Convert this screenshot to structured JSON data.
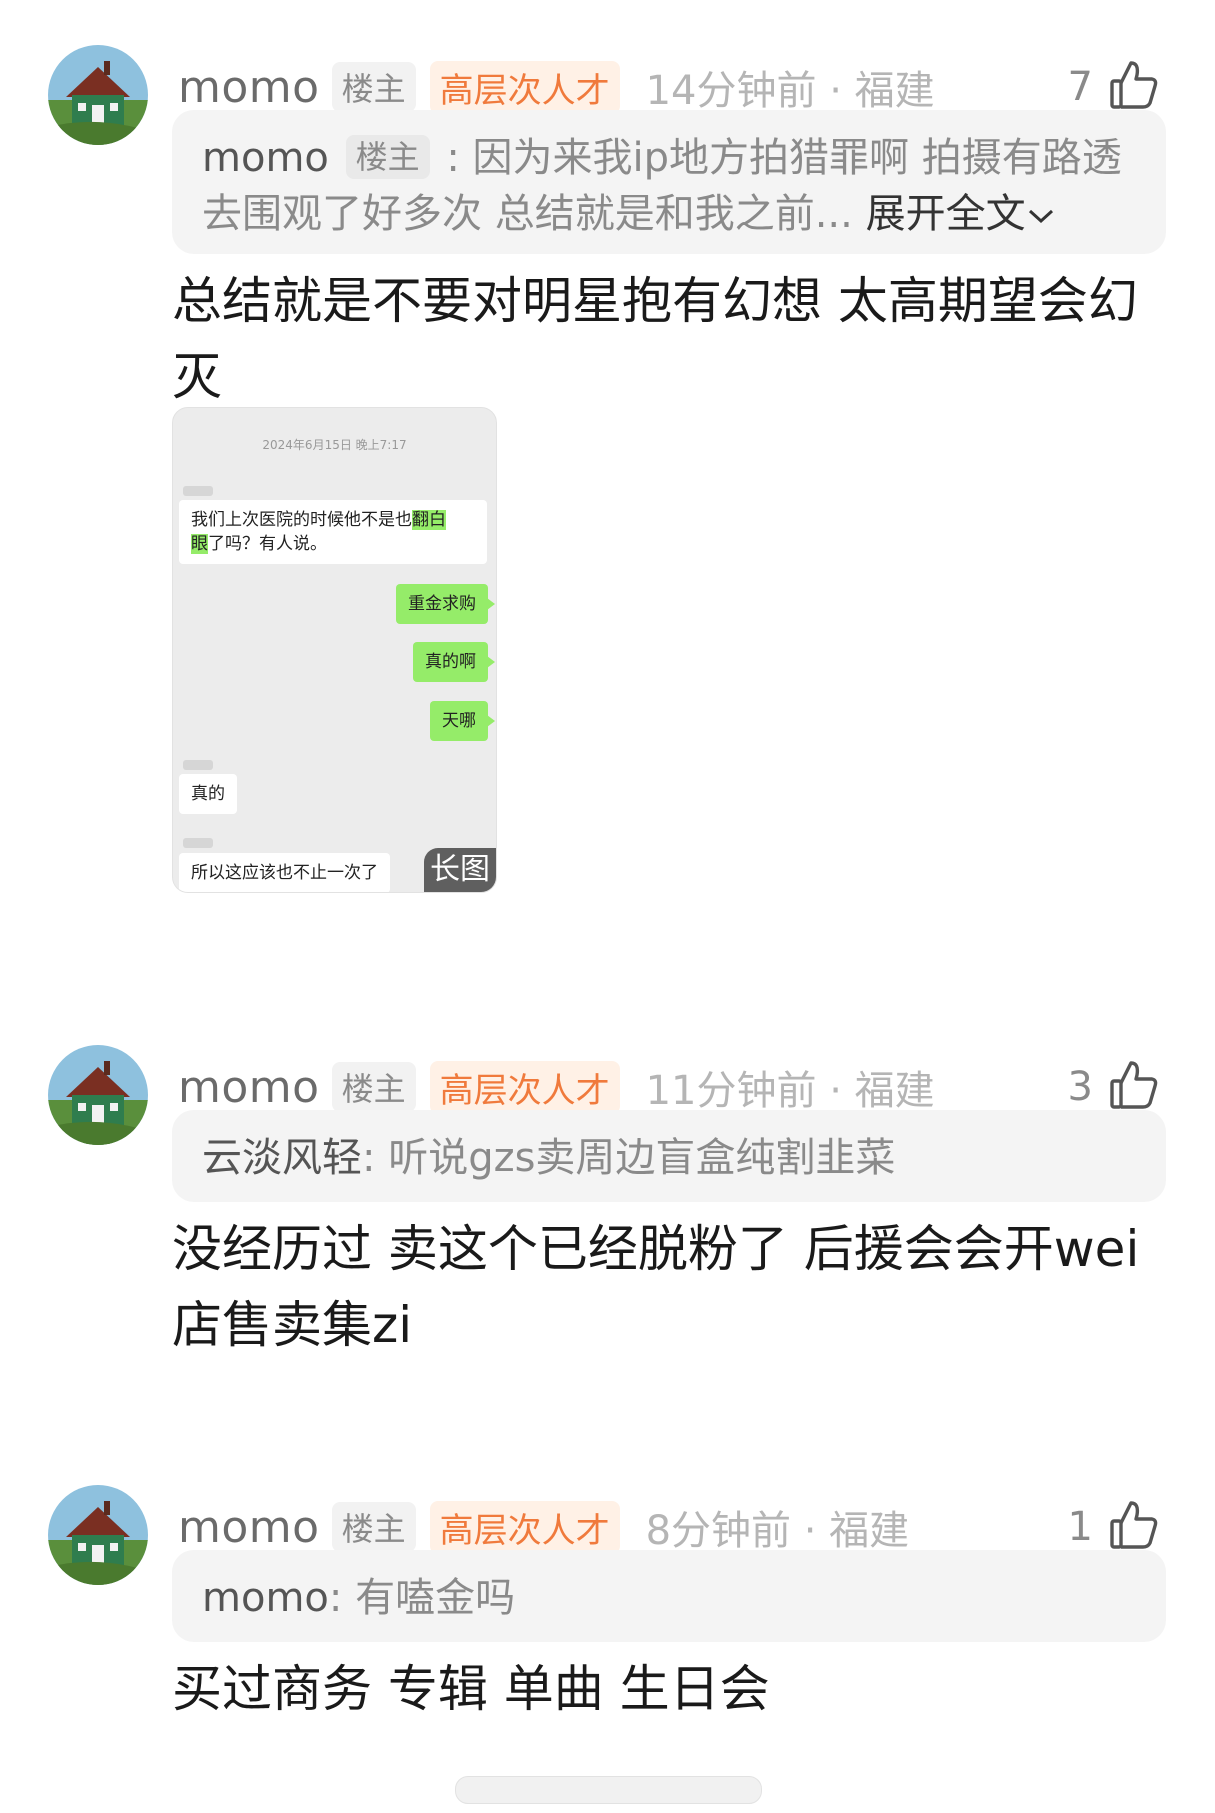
{
  "comments": [
    {
      "username": "momo",
      "owner_badge": "楼主",
      "rank_badge": "高层次人才",
      "meta": "14分钟前 · 福建",
      "likes": "7",
      "quote": {
        "name": "momo",
        "owner_badge": "楼主",
        "sep": " : ",
        "text": "因为来我ip地方拍猎罪啊 拍摄有路透去围观了好多次 总结就是和我之前...",
        "expand": "展开全文"
      },
      "body": "总结就是不要对明星抱有幻想 太高期望会幻灭",
      "attachment": {
        "date": "2024年6月15日 晚上7:17",
        "msg1_pre": "我们上次医院的时候他不是也",
        "msg1_hl1": "翻白",
        "msg1_hl2": "眼",
        "msg1_post": "了吗？有人说。",
        "msg2": "重金求购",
        "msg3": "真的啊",
        "msg4": "天哪",
        "msg5": "真的",
        "msg6": "所以这应该也不止一次了",
        "long_tag": "长图"
      }
    },
    {
      "username": "momo",
      "owner_badge": "楼主",
      "rank_badge": "高层次人才",
      "meta": "11分钟前 · 福建",
      "likes": "3",
      "quote": {
        "name": "云淡风轻",
        "sep": ": ",
        "text": "听说gzs卖周边盲盒纯割韭菜"
      },
      "body": "没经历过 卖这个已经脱粉了 后援会会开wei店售卖集zi"
    },
    {
      "username": "momo",
      "owner_badge": "楼主",
      "rank_badge": "高层次人才",
      "meta": "8分钟前 · 福建",
      "likes": "1",
      "quote": {
        "name": "momo",
        "sep": ": ",
        "text": "有嗑金吗"
      },
      "body": "买过商务 专辑 单曲 生日会"
    }
  ],
  "colors": {
    "rank_badge": "#f07a3c",
    "chat_green": "#95ec69"
  },
  "icons": {
    "like": "thumbs-up-icon",
    "expand": "chevron-down-icon"
  }
}
